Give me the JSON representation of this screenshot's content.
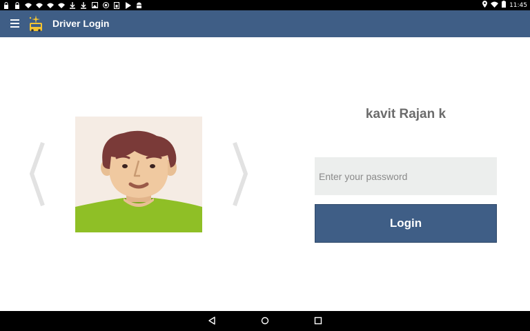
{
  "status_bar": {
    "time": "11:45",
    "left_icons": [
      "lock-icon",
      "lock-icon",
      "wifi-alert-icon",
      "wifi-alert-icon",
      "wifi-alert-icon",
      "wifi-alert-icon",
      "download-icon",
      "download-icon",
      "image-icon",
      "record-icon",
      "sim-icon",
      "play-store-icon",
      "android-icon"
    ],
    "right_icons": [
      "location-icon",
      "wifi-icon",
      "battery-icon"
    ]
  },
  "app_bar": {
    "title": "Driver Login",
    "background": "#3f5e86"
  },
  "profile": {
    "name": "kavit Rajan k"
  },
  "login_form": {
    "password_placeholder": "Enter your password",
    "password_value": "",
    "login_label": "Login"
  },
  "nav_bar": {
    "buttons": [
      "back-icon",
      "home-icon",
      "recents-icon"
    ]
  }
}
